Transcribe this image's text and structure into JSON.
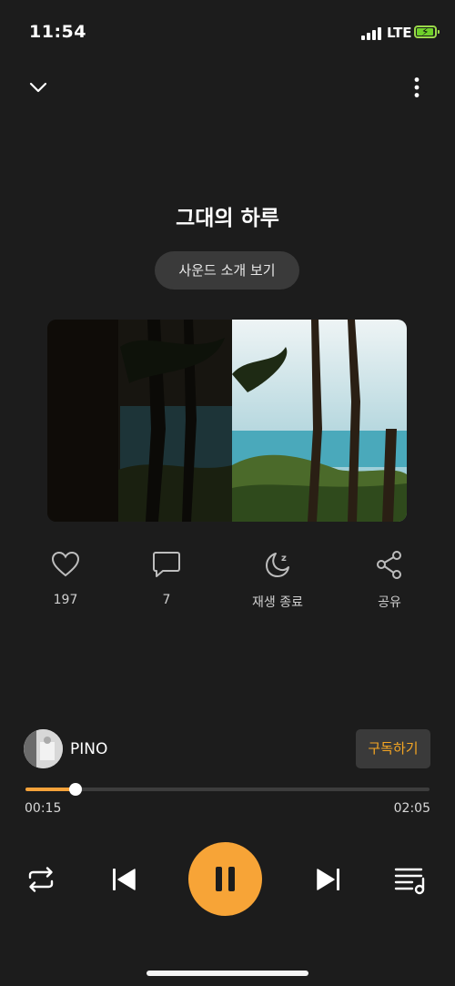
{
  "status_bar": {
    "time": "11:54",
    "network": "LTE",
    "battery_icon": "charging-battery-icon"
  },
  "sound": {
    "title": "그대의 하루",
    "intro_button": "사운드 소개 보기"
  },
  "actions": [
    {
      "icon": "heart-icon",
      "label": "197"
    },
    {
      "icon": "comment-icon",
      "label": "7"
    },
    {
      "icon": "sleep-timer-icon",
      "label": "재생 종료"
    },
    {
      "icon": "share-icon",
      "label": "공유"
    }
  ],
  "artist": {
    "name": "PINO",
    "subscribe_label": "구독하기"
  },
  "progress": {
    "current": "00:15",
    "duration": "02:05",
    "fraction": 0.124
  },
  "colors": {
    "accent": "#f7a437",
    "background": "#1c1c1c",
    "subscribe_text": "#f5a623"
  }
}
